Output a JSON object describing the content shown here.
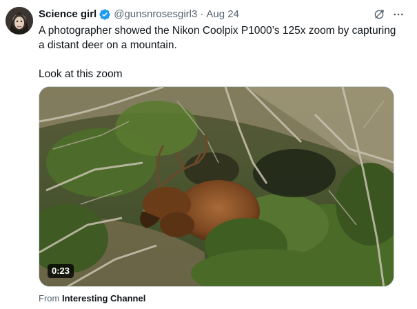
{
  "tweet": {
    "display_name": "Science girl",
    "handle": "@gunsnrosesgirl3",
    "separator": "·",
    "date": "Aug 24",
    "text_line1": "A photographer showed the Nikon Coolpix P1000’s 125x zoom by capturing",
    "text_line2": "a distant deer on a mountain.",
    "text_line3": "Look at this zoom"
  },
  "media": {
    "duration": "0:23"
  },
  "source": {
    "prefix": "From",
    "channel": "Interesting Channel"
  },
  "icons": {
    "verified": "verified-badge-icon",
    "grok": "grok-icon",
    "more": "more-icon"
  },
  "colors": {
    "verified": "#1d9bf0",
    "secondary_text": "#536471",
    "primary_text": "#0f1419"
  }
}
